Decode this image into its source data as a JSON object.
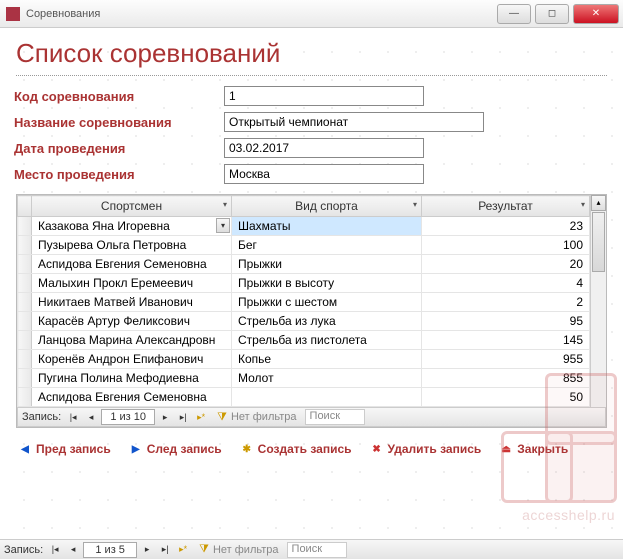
{
  "window": {
    "title": "Соревнования"
  },
  "header": {
    "title": "Список соревнований"
  },
  "form": {
    "labels": {
      "code": "Код соревнования",
      "name": "Название соревнования",
      "date": "Дата проведения",
      "place": "Место проведения"
    },
    "values": {
      "code": "1",
      "name": "Открытый чемпионат",
      "date": "03.02.2017",
      "place": "Москва"
    }
  },
  "grid": {
    "columns": {
      "athlete": "Спортсмен",
      "sport": "Вид спорта",
      "result": "Результат"
    },
    "rows": [
      {
        "athlete": "Казакова Яна Игоревна",
        "sport": "Шахматы",
        "result": 23,
        "selected": true
      },
      {
        "athlete": "Пузырева Ольга Петровна",
        "sport": "Бег",
        "result": 100
      },
      {
        "athlete": "Аспидова Евгения Семеновна",
        "sport": "Прыжки",
        "result": 20
      },
      {
        "athlete": "Малыхин Прокл Еремеевич",
        "sport": "Прыжки в высоту",
        "result": 4
      },
      {
        "athlete": "Никитаев Матвей Иванович",
        "sport": "Прыжки с шестом",
        "result": 2
      },
      {
        "athlete": "Карасёв Артур Феликсович",
        "sport": "Стрельба из лука",
        "result": 95
      },
      {
        "athlete": "Ланцова Марина Александровн",
        "sport": "Стрельба из пистолета",
        "result": 145
      },
      {
        "athlete": "Коренёв Андрон Епифанович",
        "sport": "Копье",
        "result": 955
      },
      {
        "athlete": "Пугина Полина Мефодиевна",
        "sport": "Молот",
        "result": 855
      },
      {
        "athlete": "Аспидова Евгения Семеновна",
        "sport": "",
        "result": 50
      }
    ],
    "nav": {
      "label": "Запись:",
      "counter": "1 из 10",
      "filter": "Нет фильтра",
      "search": "Поиск"
    }
  },
  "actions": {
    "prev": "Пред запись",
    "next": "След запись",
    "create": "Создать запись",
    "delete": "Удалить запись",
    "close": "Закрыть"
  },
  "outer_nav": {
    "label": "Запись:",
    "counter": "1 из 5",
    "filter": "Нет фильтра",
    "search": "Поиск"
  },
  "watermark": "accesshelp.ru"
}
